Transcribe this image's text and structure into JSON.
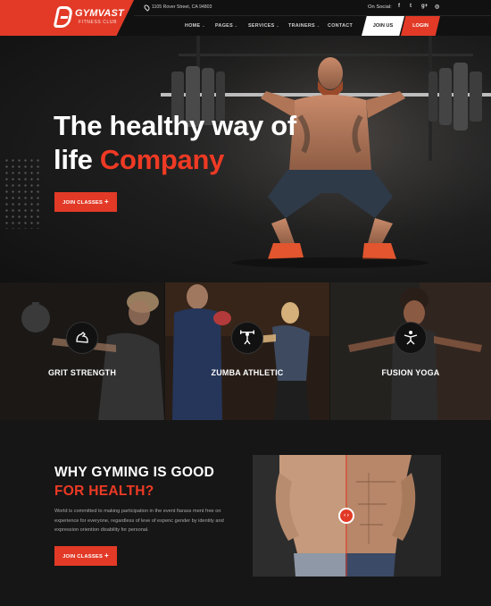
{
  "brand": {
    "name": "GYMVAST",
    "tagline": "FITNESS CLUB",
    "accent": "#e23a27"
  },
  "topbar": {
    "address": "1105 Rover Street, CA 94803",
    "social_label": "On Social:",
    "social_icons": [
      "facebook-icon",
      "twitter-icon",
      "google-plus-icon",
      "instagram-icon"
    ],
    "social_glyphs": [
      "f",
      "t",
      "g+",
      "◎"
    ]
  },
  "nav": {
    "items": [
      {
        "label": "HOME",
        "caret": "⌄"
      },
      {
        "label": "PAGES",
        "caret": "⌄"
      },
      {
        "label": "SERVICES",
        "caret": "⌄"
      },
      {
        "label": "TRAINERS",
        "caret": "⌄"
      },
      {
        "label": "CONTACT",
        "caret": ""
      }
    ],
    "join": "JOIN US",
    "login": "LOGIN"
  },
  "hero": {
    "line1": "The healthy way of",
    "line2a": "life ",
    "line2b": "Company",
    "cta": "JOIN CLASSES",
    "cta_icon": "+"
  },
  "classes": [
    {
      "label": "GRIT STRENGTH",
      "icon": "flexed-arm-icon"
    },
    {
      "label": "ZUMBA ATHLETIC",
      "icon": "weightlifter-icon"
    },
    {
      "label": "FUSION YOGA",
      "icon": "yoga-pose-icon"
    }
  ],
  "why": {
    "title1": "WHY GYMING IS GOOD",
    "title2": "FOR HEALTH?",
    "text": "World is committed to making participation in the event fiarass ment free on experience for everyone, regardless of leve of expenc gender by identity and expression oriention disability for personal.",
    "cta": "JOIN CLASSES",
    "cta_icon": "+",
    "compare_handle": "‹ ›"
  }
}
